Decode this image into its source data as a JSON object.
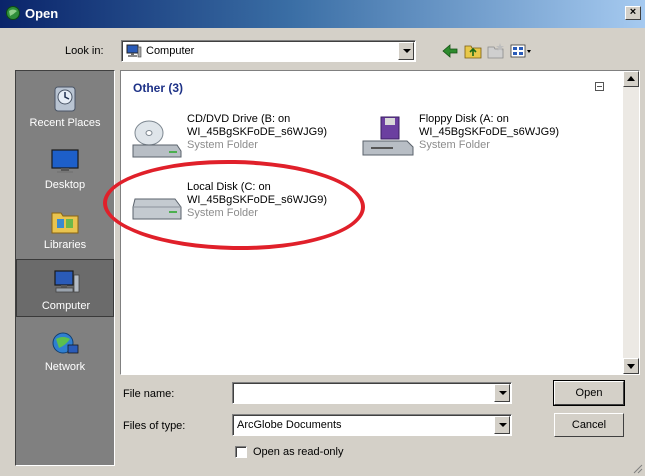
{
  "window": {
    "title": "Open",
    "close_glyph": "×",
    "accent": "#0a246a"
  },
  "toolbar": {
    "look_in_label": "Look in:",
    "look_in_value": "Computer",
    "icons": [
      "back-arrow-icon",
      "up-folder-icon",
      "new-folder-icon",
      "views-menu-icon"
    ]
  },
  "places": [
    {
      "label": "Recent Places",
      "icon": "recent-places-icon",
      "selected": false
    },
    {
      "label": "Desktop",
      "icon": "desktop-icon",
      "selected": false
    },
    {
      "label": "Libraries",
      "icon": "libraries-icon",
      "selected": false
    },
    {
      "label": "Computer",
      "icon": "computer-icon",
      "selected": true
    },
    {
      "label": "Network",
      "icon": "network-icon",
      "selected": false
    }
  ],
  "filelist": {
    "group_header": "Other (3)",
    "items": [
      {
        "name_line1": "CD/DVD Drive (B: on",
        "name_line2": "WI_45BgSKFoDE_s6WJG9)",
        "type": "System Folder",
        "icon": "cd-drive-icon"
      },
      {
        "name_line1": "Floppy Disk (A: on",
        "name_line2": "WI_45BgSKFoDE_s6WJG9)",
        "type": "System Folder",
        "icon": "floppy-drive-icon"
      },
      {
        "name_line1": "Local Disk (C: on",
        "name_line2": "WI_45BgSKFoDE_s6WJG9)",
        "type": "System Folder",
        "icon": "hard-disk-icon"
      }
    ],
    "annotation_color": "#e0202a"
  },
  "bottom": {
    "file_name_label": "File name:",
    "file_name_value": "",
    "files_of_type_label": "Files of type:",
    "files_of_type_value": "ArcGlobe Documents",
    "open_button": "Open",
    "cancel_button": "Cancel",
    "read_only_label": "Open as read-only",
    "read_only_checked": false
  }
}
